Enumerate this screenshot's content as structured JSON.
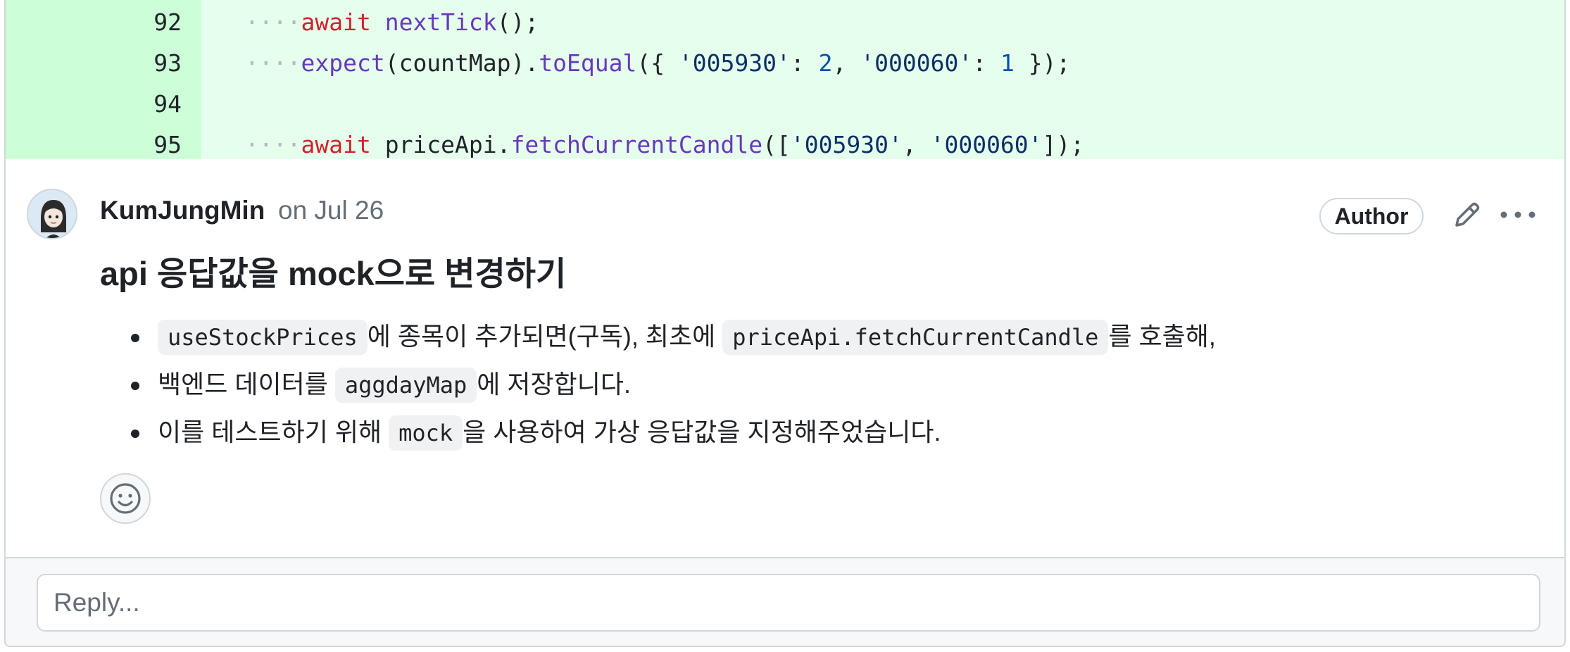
{
  "diff": {
    "lines": [
      {
        "number": "92",
        "indent": "····",
        "tokens": [
          {
            "t": "await",
            "c": "kw"
          },
          {
            "t": " ",
            "c": ""
          },
          {
            "t": "nextTick",
            "c": "fn"
          },
          {
            "t": "();",
            "c": ""
          }
        ]
      },
      {
        "number": "93",
        "indent": "····",
        "tokens": [
          {
            "t": "expect",
            "c": "fn"
          },
          {
            "t": "(countMap).",
            "c": ""
          },
          {
            "t": "toEqual",
            "c": "fn"
          },
          {
            "t": "({ ",
            "c": ""
          },
          {
            "t": "'005930'",
            "c": "str"
          },
          {
            "t": ": ",
            "c": ""
          },
          {
            "t": "2",
            "c": "num"
          },
          {
            "t": ", ",
            "c": ""
          },
          {
            "t": "'000060'",
            "c": "str"
          },
          {
            "t": ": ",
            "c": ""
          },
          {
            "t": "1",
            "c": "num"
          },
          {
            "t": " });",
            "c": ""
          }
        ]
      },
      {
        "number": "94",
        "indent": "",
        "tokens": []
      },
      {
        "number": "95",
        "indent": "····",
        "tokens": [
          {
            "t": "await",
            "c": "kw"
          },
          {
            "t": " priceApi.",
            "c": ""
          },
          {
            "t": "fetchCurrentCandle",
            "c": "fn"
          },
          {
            "t": "([",
            "c": ""
          },
          {
            "t": "'005930'",
            "c": "str"
          },
          {
            "t": ", ",
            "c": ""
          },
          {
            "t": "'000060'",
            "c": "str"
          },
          {
            "t": "]);",
            "c": ""
          }
        ]
      }
    ]
  },
  "comment": {
    "author": "KumJungMin",
    "date": "on Jul 26",
    "badge": "Author",
    "title": "api 응답값을 mock으로 변경하기",
    "bullets": [
      [
        {
          "code": "useStockPrices"
        },
        {
          "text": "에 종목이 추가되면(구독), 최초에 "
        },
        {
          "code": "priceApi.fetchCurrentCandle"
        },
        {
          "text": "를 호출해,"
        }
      ],
      [
        {
          "text": "백엔드 데이터를 "
        },
        {
          "code": "aggdayMap"
        },
        {
          "text": "에 저장합니다."
        }
      ],
      [
        {
          "text": "이를 테스트하기 위해 "
        },
        {
          "code": "mock"
        },
        {
          "text": "을 사용하여 가상 응답값을 지정해주었습니다."
        }
      ]
    ],
    "icons": {
      "edit": "pencil-icon",
      "more": "kebab-horizontal-icon",
      "reaction": "smiley-icon"
    }
  },
  "reply": {
    "placeholder": "Reply..."
  },
  "colors": {
    "added_line_bg": "#e6ffec",
    "added_gutter_bg": "#ccffd8",
    "keyword": "#cf222e",
    "function": "#6639ba",
    "string": "#0a3069",
    "number": "#0550ae"
  }
}
